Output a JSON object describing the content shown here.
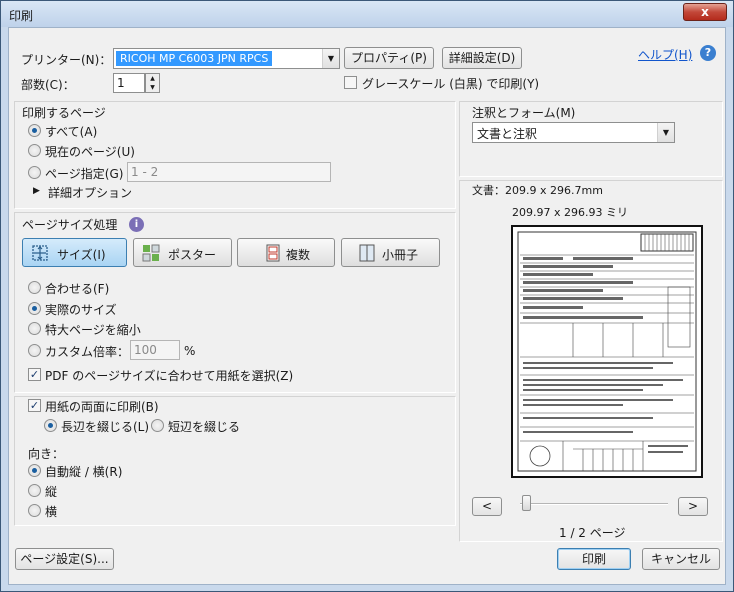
{
  "window": {
    "title": "印刷",
    "close_label": "x"
  },
  "printer": {
    "label": "プリンター(N)：",
    "selected": "RICOH MP C6003 JPN RPCS",
    "properties_button": "プロパティ(P)",
    "advanced_button": "詳細設定(D)",
    "help_link": "ヘルプ(H)",
    "copies_label": "部数(C)：",
    "copies_value": "1",
    "grayscale_label": "グレースケール (白黒) で印刷(Y)",
    "grayscale_checked": false
  },
  "pages": {
    "heading": "印刷するページ",
    "all": "すべて(A)",
    "current": "現在のページ(U)",
    "range": "ページ指定(G)",
    "range_value": "1 - 2",
    "more_options": "詳細オプション",
    "selected": "all"
  },
  "sizing": {
    "heading": "ページサイズ処理",
    "buttons": [
      "サイズ(I)",
      "ポスター",
      "複数",
      "小冊子"
    ],
    "active": 0,
    "fit": "合わせる(F)",
    "actual": "実際のサイズ",
    "shrink": "特大ページを縮小",
    "custom": "カスタム倍率：",
    "custom_value": "100",
    "percent": "%",
    "choose_paper": "PDF のページサイズに合わせて用紙を選択(Z)",
    "choose_paper_checked": true,
    "selected": "actual"
  },
  "duplex": {
    "label": "用紙の両面に印刷(B)",
    "checked": true,
    "long_edge": "長辺を綴じる(L)",
    "short_edge": "短辺を綴じる",
    "selected": "long"
  },
  "orientation": {
    "heading": "向き：",
    "auto": "自動縦 / 横(R)",
    "portrait": "縦",
    "landscape": "横",
    "selected": "auto"
  },
  "comments": {
    "heading": "注釈とフォーム(M)",
    "selected": "文書と注釈"
  },
  "preview": {
    "document_size": "文書：209.9 x 296.7mm",
    "page_size": "209.97 x 296.93 ミリ",
    "prev_label": "<",
    "next_label": ">",
    "page_indicator": "1 / 2 ページ"
  },
  "footer": {
    "page_setup": "ページ設定(S)...",
    "print": "印刷",
    "cancel": "キャンセル"
  }
}
